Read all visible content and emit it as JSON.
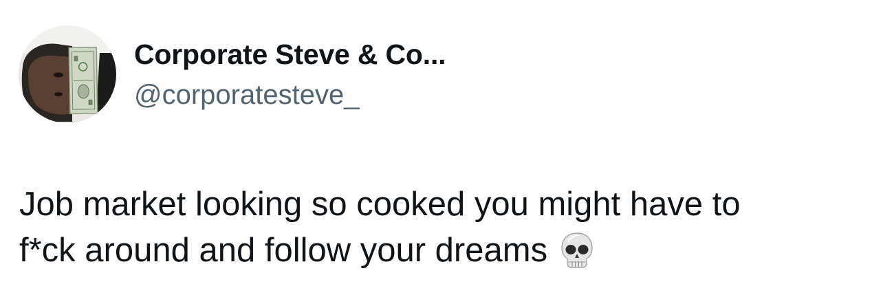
{
  "author": {
    "display_name": "Corporate Steve & Co...",
    "handle": "@corporatesteve_",
    "avatar_icon": "profile-photo-with-dollar-bill"
  },
  "tweet": {
    "line1": "Job market looking so cooked you might have to",
    "line2": "f*ck around and follow your dreams",
    "emoji_icon": "skull-emoji"
  },
  "colors": {
    "text_primary": "#0f1419",
    "text_secondary": "#536471",
    "background": "#ffffff"
  }
}
